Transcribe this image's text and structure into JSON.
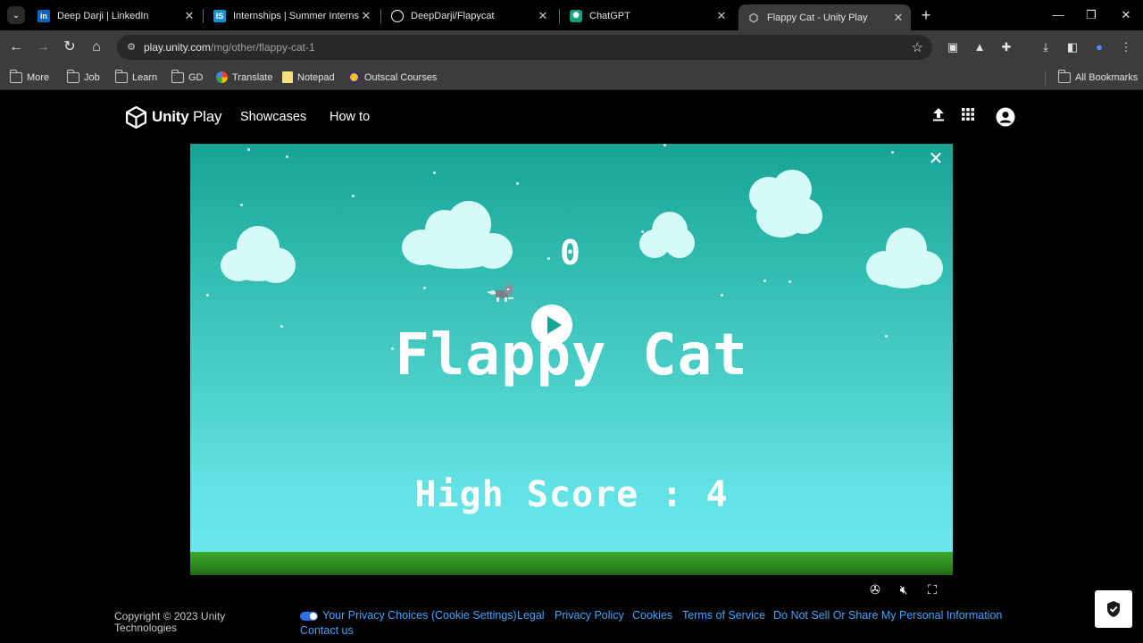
{
  "browser": {
    "tabs": [
      {
        "title": "Deep Darji | LinkedIn",
        "icon": "linkedin-icon",
        "active": false
      },
      {
        "title": "Internships | Summer Internship",
        "icon": "internshala-icon",
        "active": false
      },
      {
        "title": "DeepDarji/Flapycat",
        "icon": "github-icon",
        "active": false
      },
      {
        "title": "ChatGPT",
        "icon": "chatgpt-icon",
        "active": false
      },
      {
        "title": "Flappy Cat - Unity Play",
        "icon": "unity-icon",
        "active": true
      }
    ],
    "address": {
      "domain": "play.unity.com",
      "path": "/mg/other/flappy-cat-1"
    },
    "bookmarks": [
      {
        "label": "More",
        "icon": "folder-icon"
      },
      {
        "label": "Job",
        "icon": "folder-icon"
      },
      {
        "label": "Learn",
        "icon": "folder-icon"
      },
      {
        "label": "GD",
        "icon": "folder-icon"
      },
      {
        "label": "Translate",
        "icon": "google-icon"
      },
      {
        "label": "Notepad",
        "icon": "notepad-icon"
      },
      {
        "label": "Outscal Courses",
        "icon": "outscal-icon"
      }
    ],
    "all_bookmarks": "All Bookmarks"
  },
  "unity": {
    "logo_bold": "Unity",
    "logo_light": " Play",
    "nav": [
      "Showcases",
      "How to"
    ]
  },
  "game": {
    "score": "0",
    "title": "Flappy Cat",
    "high_score": "High Score : 4"
  },
  "footer": {
    "copyright": "Copyright © 2023 Unity Technologies",
    "links": [
      "Your Privacy Choices (Cookie Settings)",
      "Legal",
      "Privacy Policy",
      "Cookies",
      "Terms of Service",
      "Do Not Sell Or Share My Personal Information"
    ],
    "contact": "Contact us"
  },
  "colors": {
    "sky_top": "#17a396",
    "sky_bottom": "#6ee8f0",
    "ground": "#3aa92a",
    "link": "#3ea6ff",
    "chrome_toolbar": "#3c3c3c"
  }
}
